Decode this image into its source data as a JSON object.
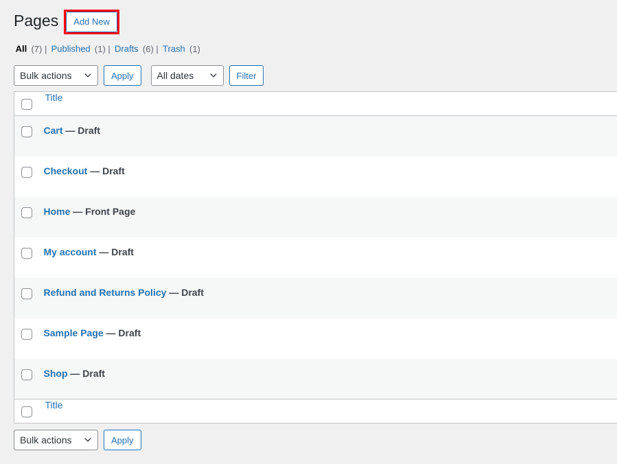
{
  "header": {
    "title": "Pages",
    "add_new_label": "Add New",
    "annotation_color": "#ff0000"
  },
  "status_filters": {
    "separator": "|",
    "items": [
      {
        "label": "All",
        "count": "(7)",
        "current": true
      },
      {
        "label": "Published",
        "count": "(1)",
        "current": false
      },
      {
        "label": "Drafts",
        "count": "(6)",
        "current": false
      },
      {
        "label": "Trash",
        "count": "(1)",
        "current": false
      }
    ]
  },
  "tablenav_top": {
    "bulk_actions_value": "Bulk actions",
    "apply_label": "Apply",
    "dates_value": "All dates",
    "filter_label": "Filter"
  },
  "table": {
    "column_title": "Title",
    "rows": [
      {
        "title": "Cart",
        "state": "— Draft"
      },
      {
        "title": "Checkout",
        "state": "— Draft"
      },
      {
        "title": "Home",
        "state": "— Front Page"
      },
      {
        "title": "My account",
        "state": "— Draft"
      },
      {
        "title": "Refund and Returns Policy",
        "state": "— Draft"
      },
      {
        "title": "Sample Page",
        "state": "— Draft"
      },
      {
        "title": "Shop",
        "state": "— Draft"
      }
    ]
  },
  "tablenav_bottom": {
    "bulk_actions_value": "Bulk actions",
    "apply_label": "Apply"
  },
  "colors": {
    "link": "#2271b1",
    "text": "#3c434a",
    "page_bg": "#f0f0f1",
    "row_alt_bg": "#f6f7f7",
    "border": "#c3c4c7"
  }
}
